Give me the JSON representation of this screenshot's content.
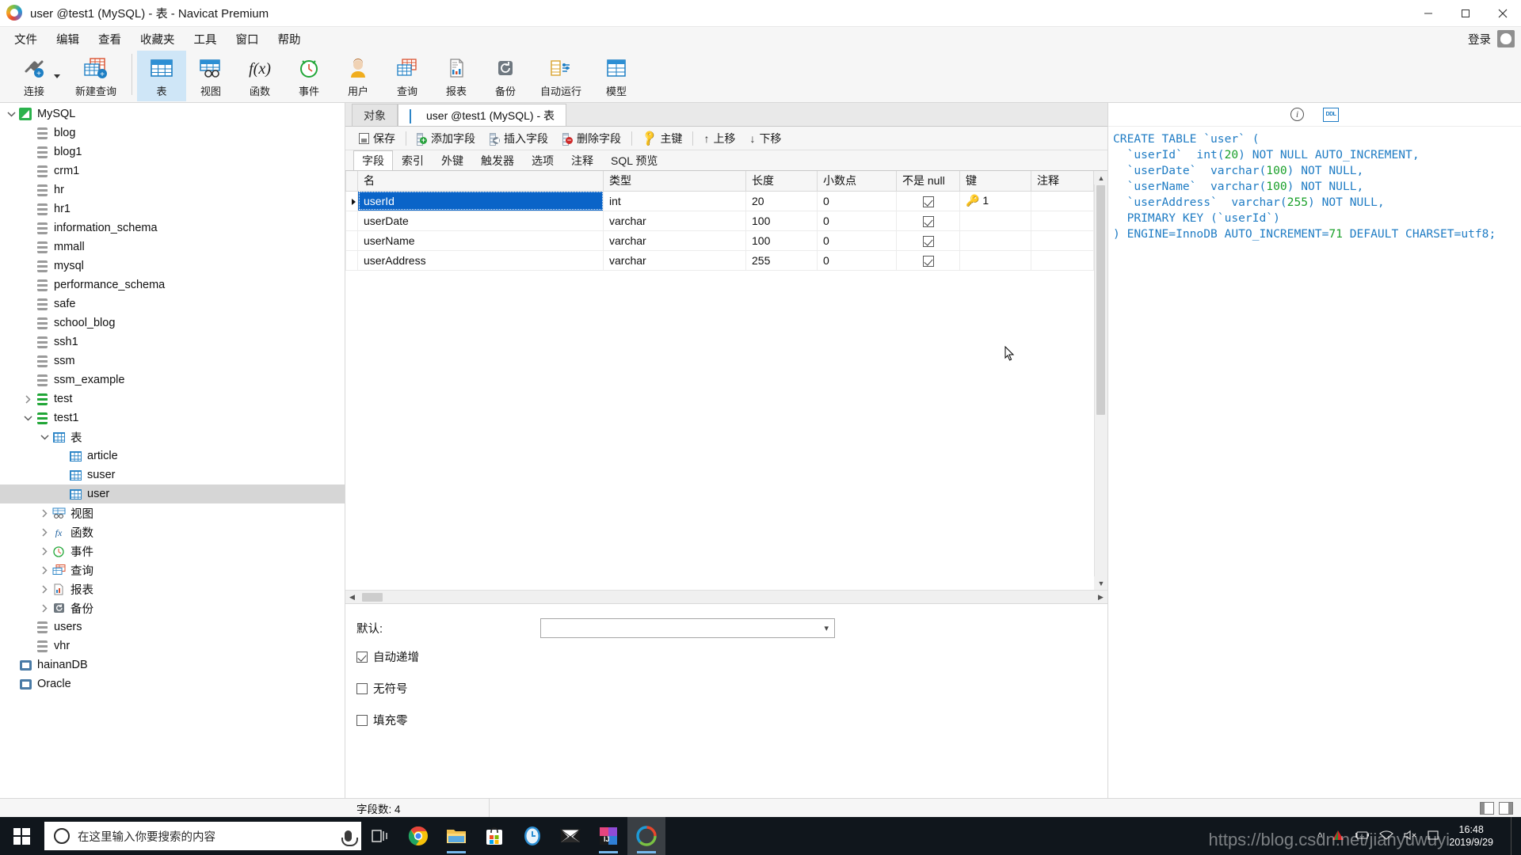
{
  "window": {
    "title": "user @test1 (MySQL) - 表 - Navicat Premium",
    "app_icon": "navicat-logo-icon",
    "minimize": "minimize-icon",
    "maximize": "maximize-icon",
    "close": "close-icon"
  },
  "menubar": {
    "items": [
      "文件",
      "编辑",
      "查看",
      "收藏夹",
      "工具",
      "窗口",
      "帮助"
    ],
    "login_label": "登录",
    "avatar": "user-avatar-icon"
  },
  "toolbar": {
    "items": [
      {
        "label": "连接",
        "icon": "connection-icon",
        "active": false,
        "has_dropdown": true
      },
      {
        "label": "新建查询",
        "icon": "new-query-icon",
        "active": false
      },
      {
        "label": "表",
        "icon": "table-icon",
        "active": true
      },
      {
        "label": "视图",
        "icon": "view-icon",
        "active": false
      },
      {
        "label": "函数",
        "icon": "function-icon",
        "active": false
      },
      {
        "label": "事件",
        "icon": "event-clock-icon",
        "active": false
      },
      {
        "label": "用户",
        "icon": "user-icon",
        "active": false
      },
      {
        "label": "查询",
        "icon": "query-icon",
        "active": false
      },
      {
        "label": "报表",
        "icon": "report-icon",
        "active": false
      },
      {
        "label": "备份",
        "icon": "backup-icon",
        "active": false
      },
      {
        "label": "自动运行",
        "icon": "automation-icon",
        "active": false
      },
      {
        "label": "模型",
        "icon": "model-icon",
        "active": false
      }
    ]
  },
  "sidebar": {
    "items": [
      {
        "label": "MySQL",
        "depth": 0,
        "icon": "mysql-connection-icon",
        "twisty": "expanded"
      },
      {
        "label": "blog",
        "depth": 1,
        "icon": "database-icon",
        "twisty": "none"
      },
      {
        "label": "blog1",
        "depth": 1,
        "icon": "database-icon",
        "twisty": "none"
      },
      {
        "label": "crm1",
        "depth": 1,
        "icon": "database-icon",
        "twisty": "none"
      },
      {
        "label": "hr",
        "depth": 1,
        "icon": "database-icon",
        "twisty": "none"
      },
      {
        "label": "hr1",
        "depth": 1,
        "icon": "database-icon",
        "twisty": "none"
      },
      {
        "label": "information_schema",
        "depth": 1,
        "icon": "database-icon",
        "twisty": "none"
      },
      {
        "label": "mmall",
        "depth": 1,
        "icon": "database-icon",
        "twisty": "none"
      },
      {
        "label": "mysql",
        "depth": 1,
        "icon": "database-icon",
        "twisty": "none"
      },
      {
        "label": "performance_schema",
        "depth": 1,
        "icon": "database-icon",
        "twisty": "none"
      },
      {
        "label": "safe",
        "depth": 1,
        "icon": "database-icon",
        "twisty": "none"
      },
      {
        "label": "school_blog",
        "depth": 1,
        "icon": "database-icon",
        "twisty": "none"
      },
      {
        "label": "ssh1",
        "depth": 1,
        "icon": "database-icon",
        "twisty": "none"
      },
      {
        "label": "ssm",
        "depth": 1,
        "icon": "database-icon",
        "twisty": "none"
      },
      {
        "label": "ssm_example",
        "depth": 1,
        "icon": "database-icon",
        "twisty": "none"
      },
      {
        "label": "test",
        "depth": 1,
        "icon": "database-open-icon",
        "twisty": "collapsed"
      },
      {
        "label": "test1",
        "depth": 1,
        "icon": "database-open-icon",
        "twisty": "expanded"
      },
      {
        "label": "表",
        "depth": 2,
        "icon": "tables-folder-icon",
        "twisty": "expanded"
      },
      {
        "label": "article",
        "depth": 3,
        "icon": "table-icon",
        "twisty": "none"
      },
      {
        "label": "suser",
        "depth": 3,
        "icon": "table-icon",
        "twisty": "none"
      },
      {
        "label": "user",
        "depth": 3,
        "icon": "table-icon",
        "twisty": "none",
        "selected": true
      },
      {
        "label": "视图",
        "depth": 2,
        "icon": "views-folder-icon",
        "twisty": "collapsed"
      },
      {
        "label": "函数",
        "depth": 2,
        "icon": "functions-folder-icon",
        "twisty": "collapsed"
      },
      {
        "label": "事件",
        "depth": 2,
        "icon": "events-folder-icon",
        "twisty": "collapsed"
      },
      {
        "label": "查询",
        "depth": 2,
        "icon": "queries-folder-icon",
        "twisty": "collapsed"
      },
      {
        "label": "报表",
        "depth": 2,
        "icon": "reports-folder-icon",
        "twisty": "collapsed"
      },
      {
        "label": "备份",
        "depth": 2,
        "icon": "backups-folder-icon",
        "twisty": "collapsed"
      },
      {
        "label": "users",
        "depth": 1,
        "icon": "database-icon",
        "twisty": "none"
      },
      {
        "label": "vhr",
        "depth": 1,
        "icon": "database-icon",
        "twisty": "none"
      },
      {
        "label": "hainanDB",
        "depth": 0,
        "icon": "connection-other-icon",
        "twisty": "none"
      },
      {
        "label": "Oracle",
        "depth": 0,
        "icon": "connection-other-icon",
        "twisty": "none"
      }
    ]
  },
  "doc_tabs": [
    {
      "label": "对象",
      "active": false
    },
    {
      "label": "user @test1 (MySQL) - 表",
      "active": true,
      "icon": "table-design-icon"
    }
  ],
  "actions": [
    {
      "label": "保存",
      "icon": "save-icon"
    },
    {
      "label": "添加字段",
      "icon": "add-field-icon"
    },
    {
      "label": "插入字段",
      "icon": "insert-field-icon"
    },
    {
      "label": "删除字段",
      "icon": "delete-field-icon"
    },
    {
      "label": "主键",
      "icon": "primary-key-icon"
    },
    {
      "label": "上移",
      "icon": "move-up-icon"
    },
    {
      "label": "下移",
      "icon": "move-down-icon"
    }
  ],
  "field_tabs": [
    {
      "label": "字段",
      "active": true
    },
    {
      "label": "索引",
      "active": false
    },
    {
      "label": "外键",
      "active": false
    },
    {
      "label": "触发器",
      "active": false
    },
    {
      "label": "选项",
      "active": false
    },
    {
      "label": "注释",
      "active": false
    },
    {
      "label": "SQL 预览",
      "active": false
    }
  ],
  "grid": {
    "columns": [
      "名",
      "类型",
      "长度",
      "小数点",
      "不是 null",
      "键",
      "注释"
    ],
    "rows": [
      {
        "name": "userId",
        "type": "int",
        "length": "20",
        "decimals": "0",
        "not_null": true,
        "key": "1",
        "comment": "",
        "selected": true
      },
      {
        "name": "userDate",
        "type": "varchar",
        "length": "100",
        "decimals": "0",
        "not_null": true,
        "key": "",
        "comment": "",
        "selected": false
      },
      {
        "name": "userName",
        "type": "varchar",
        "length": "100",
        "decimals": "0",
        "not_null": true,
        "key": "",
        "comment": "",
        "selected": false
      },
      {
        "name": "userAddress",
        "type": "varchar",
        "length": "255",
        "decimals": "0",
        "not_null": true,
        "key": "",
        "comment": "",
        "selected": false
      }
    ]
  },
  "detail": {
    "default_label": "默认:",
    "default_value": "",
    "checkboxes": [
      {
        "label": "自动递增",
        "checked": true
      },
      {
        "label": "无符号",
        "checked": false
      },
      {
        "label": "填充零",
        "checked": false
      }
    ]
  },
  "sql_preview": {
    "info_icon": "info-icon",
    "ddl_icon": "ddl-icon",
    "lines": [
      "CREATE TABLE `user` (",
      "  `userId`  int(20) NOT NULL AUTO_INCREMENT,",
      "  `userDate`  varchar(100) NOT NULL,",
      "  `userName`  varchar(100) NOT NULL,",
      "  `userAddress`  varchar(255) NOT NULL,",
      "  PRIMARY KEY (`userId`)",
      ") ENGINE=InnoDB AUTO_INCREMENT=71 DEFAULT CHARSET=utf8;"
    ]
  },
  "statusbar": {
    "field_count": "字段数: 4",
    "pane_left_icon": "pane-left-icon",
    "pane_right_icon": "pane-right-icon"
  },
  "taskbar": {
    "start_icon": "windows-start-icon",
    "search_placeholder": "在这里输入你要搜索的内容",
    "search_value": "",
    "cortana_icon": "cortana-circle-icon",
    "mic_icon": "microphone-icon",
    "apps": [
      {
        "icon": "task-view-icon",
        "running": false,
        "active": false
      },
      {
        "icon": "chrome-icon",
        "running": false,
        "active": false
      },
      {
        "icon": "file-explorer-icon",
        "running": true,
        "active": false
      },
      {
        "icon": "microsoft-store-icon",
        "running": false,
        "active": false
      },
      {
        "icon": "clock-icon",
        "running": false,
        "active": false
      },
      {
        "icon": "mail-icon",
        "running": false,
        "active": false
      },
      {
        "icon": "intellij-idea-icon",
        "running": true,
        "active": false
      },
      {
        "icon": "navicat-icon",
        "running": true,
        "active": true
      }
    ],
    "tray": [
      "chevron-up-icon",
      "security-icon",
      "battery-icon",
      "wifi-icon",
      "volume-mute-icon",
      "action-center-icon"
    ],
    "time": "16:48",
    "date": "2019/9/29"
  },
  "watermark": "https://blog.csdn.net/jianyuwuyi",
  "colors": {
    "accent_blue": "#0a64c8",
    "toolbar_active": "#cfe6f7",
    "sql_blue": "#1e6fd9",
    "sql_green": "#1aa02a",
    "taskbar_bg": "#10161c"
  }
}
